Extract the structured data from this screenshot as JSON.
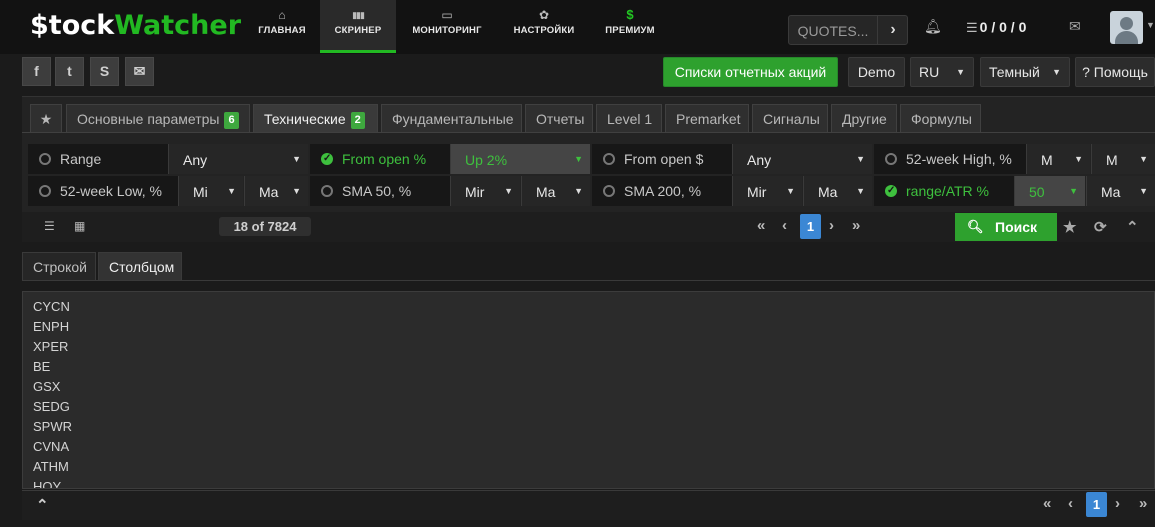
{
  "brand": {
    "logo_dollar": "$",
    "logo_part1": "tock",
    "logo_part2": "Watcher"
  },
  "nav": [
    {
      "icon": "home-icon",
      "glyph": "⌂",
      "label": "ГЛАВНАЯ"
    },
    {
      "icon": "bar-chart-icon",
      "glyph": "▮▮▮",
      "label": "СКРИНЕР"
    },
    {
      "icon": "monitor-icon",
      "glyph": "▭",
      "label": "МОНИТОРИНГ"
    },
    {
      "icon": "gear-icon",
      "glyph": "✿",
      "label": "НАСТРОЙКИ"
    },
    {
      "icon": "dollar-icon",
      "glyph": "$",
      "label": "ПРЕМИУМ"
    }
  ],
  "quotes": {
    "placeholder": "QUOTES...",
    "arrow": "›"
  },
  "counters": {
    "value": "0 / 0 / 0"
  },
  "social": [
    {
      "icon": "facebook-icon",
      "glyph": "f"
    },
    {
      "icon": "twitter-icon",
      "glyph": "t"
    },
    {
      "icon": "skype-icon",
      "glyph": "S"
    },
    {
      "icon": "email-icon",
      "glyph": "✉"
    }
  ],
  "toolbar": {
    "reports_label": "Списки отчетных акций",
    "demo_label": "Demo",
    "lang": "RU",
    "theme": "Темный",
    "help_label": "? Помощь"
  },
  "tabs": [
    {
      "label": "Основные параметры",
      "badge": "6"
    },
    {
      "label": "Технические",
      "badge": "2"
    },
    {
      "label": "Фундаментальные",
      "badge": ""
    },
    {
      "label": "Отчеты",
      "badge": ""
    },
    {
      "label": "Level 1",
      "badge": ""
    },
    {
      "label": "Premarket",
      "badge": ""
    },
    {
      "label": "Сигналы",
      "badge": ""
    },
    {
      "label": "Другие",
      "badge": ""
    },
    {
      "label": "Формулы",
      "badge": ""
    }
  ],
  "filters_row1": [
    {
      "label": "Range",
      "v1": "Any",
      "v2": "",
      "active": false
    },
    {
      "label": "From open %",
      "v1": "Up 2%",
      "v2": "",
      "active": true
    },
    {
      "label": "From open $",
      "v1": "Any",
      "v2": "",
      "active": false
    },
    {
      "label": "52-week High, %",
      "v1": "M",
      "v2": "M",
      "active": false
    }
  ],
  "filters_row2": [
    {
      "label": "52-week Low, %",
      "v1": "Mi",
      "v2": "Ma",
      "active": false
    },
    {
      "label": "SMA 50, %",
      "v1": "Mir",
      "v2": "Ma",
      "active": false
    },
    {
      "label": "SMA 200, %",
      "v1": "Mir",
      "v2": "Ma",
      "active": false
    },
    {
      "label": "range/ATR %",
      "v1": "50",
      "v2": "Ma",
      "active": true
    }
  ],
  "results": {
    "count": "18 of 7824",
    "page": "1"
  },
  "search": {
    "label": "Поиск"
  },
  "view_tabs": [
    "Строкой",
    "Столбцом"
  ],
  "tickers": [
    "CYCN",
    "ENPH",
    "XPER",
    "BE",
    "GSX",
    "SEDG",
    "SPWR",
    "CVNA",
    "ATHM",
    "HOY"
  ],
  "colors": {
    "accent": "#2ea12e",
    "page_active": "#3b87d4",
    "background": "#1b1b1b"
  }
}
